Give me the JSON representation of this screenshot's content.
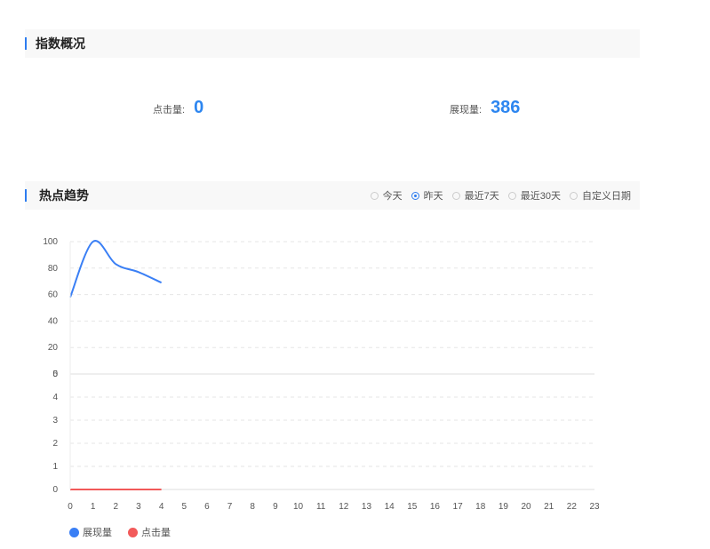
{
  "overview": {
    "title": "指数概况",
    "clicks_label": "点击量:",
    "clicks_value": "0",
    "views_label": "展现量:",
    "views_value": "386"
  },
  "trend": {
    "title": "热点趋势",
    "options": [
      {
        "label": "今天",
        "selected": false
      },
      {
        "label": "昨天",
        "selected": true
      },
      {
        "label": "最近7天",
        "selected": false
      },
      {
        "label": "最近30天",
        "selected": false
      },
      {
        "label": "自定义日期",
        "selected": false
      }
    ]
  },
  "colors": {
    "views": "#3a7ff5",
    "clicks": "#f25a5a"
  },
  "chart_data": {
    "type": "line",
    "x": [
      0,
      1,
      2,
      3,
      4
    ],
    "xticks": [
      "0",
      "1",
      "2",
      "3",
      "4",
      "5",
      "6",
      "7",
      "8",
      "9",
      "10",
      "11",
      "12",
      "13",
      "14",
      "15",
      "16",
      "17",
      "18",
      "19",
      "20",
      "21",
      "22",
      "23"
    ],
    "xlim": [
      0,
      23
    ],
    "series": [
      {
        "name": "展现量",
        "values": [
          58,
          100,
          83,
          77,
          69
        ],
        "ylim": [
          0,
          100
        ],
        "yticks": [
          "0",
          "20",
          "40",
          "60",
          "80",
          "100"
        ]
      },
      {
        "name": "点击量",
        "values": [
          0,
          0,
          0,
          0,
          0
        ],
        "ylim": [
          0,
          5
        ],
        "yticks": [
          "0",
          "1",
          "2",
          "3",
          "4",
          "5"
        ]
      }
    ],
    "legend": "bottom-left"
  }
}
